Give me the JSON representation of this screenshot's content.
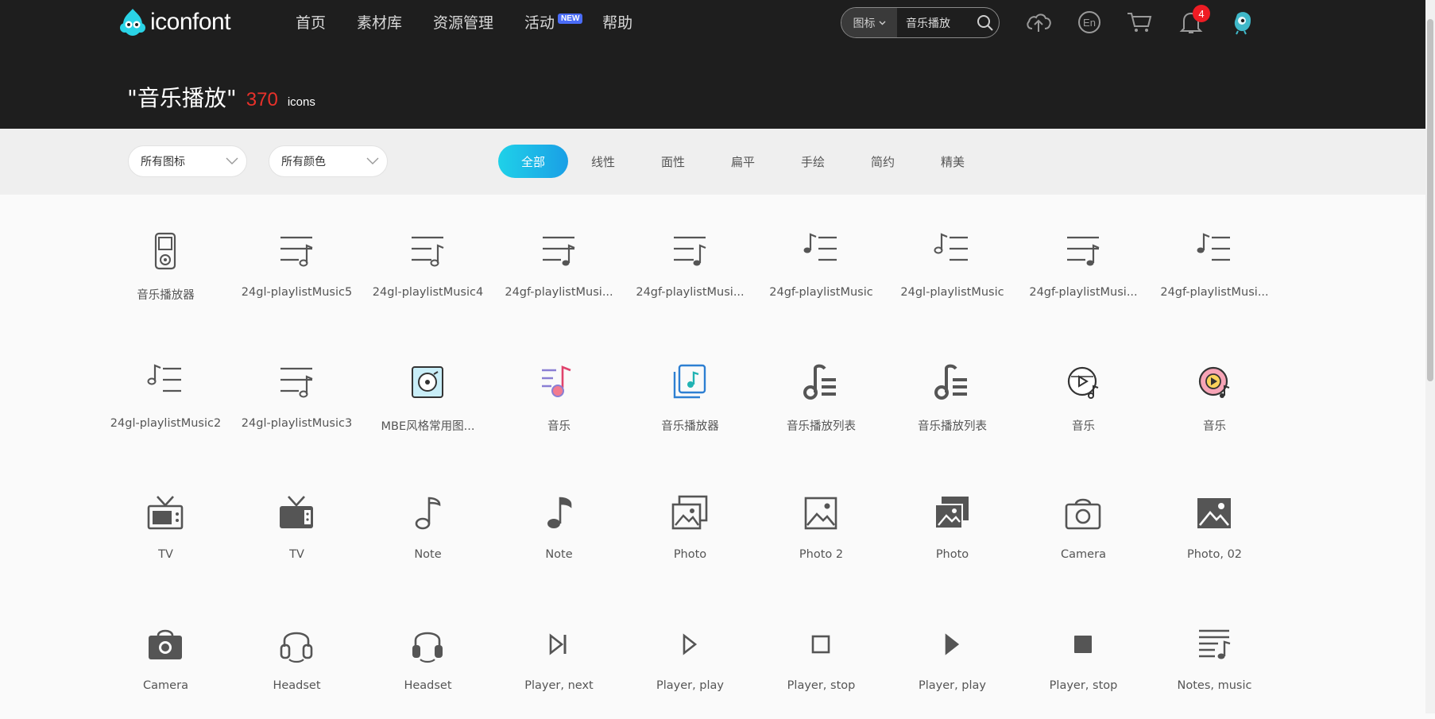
{
  "brand": {
    "name": "iconfont"
  },
  "nav": [
    {
      "label": "首页"
    },
    {
      "label": "素材库"
    },
    {
      "label": "资源管理"
    },
    {
      "label": "活动",
      "badge": "NEW"
    },
    {
      "label": "帮助"
    }
  ],
  "search": {
    "type": "图标",
    "query": "音乐播放"
  },
  "header_icons": [
    "upload-icon",
    "language-en-icon",
    "cart-icon",
    "bell-icon",
    "avatar"
  ],
  "notifications": {
    "count": "4"
  },
  "results": {
    "query_display": "\"音乐播放\"",
    "count": "370",
    "unit": "icons"
  },
  "filters": {
    "icon_type": "所有图标",
    "color": "所有颜色",
    "styles": [
      "全部",
      "线性",
      "面性",
      "扁平",
      "手绘",
      "简约",
      "精美"
    ],
    "active_style": "全部"
  },
  "icons": [
    {
      "label": "音乐播放器",
      "icon": "music-player-device-icon"
    },
    {
      "label": "24gl-playlistMusic5",
      "icon": "playlist-music-icon"
    },
    {
      "label": "24gl-playlistMusic4",
      "icon": "playlist-music-icon"
    },
    {
      "label": "24gf-playlistMusi...",
      "icon": "playlist-music-icon"
    },
    {
      "label": "24gf-playlistMusi...",
      "icon": "playlist-music-icon"
    },
    {
      "label": "24gf-playlistMusic",
      "icon": "playlist-music-icon"
    },
    {
      "label": "24gl-playlistMusic",
      "icon": "playlist-music-icon"
    },
    {
      "label": "24gf-playlistMusi...",
      "icon": "playlist-music-icon"
    },
    {
      "label": "24gf-playlistMusi...",
      "icon": "playlist-music-icon"
    },
    {
      "label": "24gl-playlistMusic2",
      "icon": "playlist-music-icon"
    },
    {
      "label": "24gl-playlistMusic3",
      "icon": "playlist-music-icon"
    },
    {
      "label": "MBE风格常用图...",
      "icon": "mbe-music-player-icon"
    },
    {
      "label": "音乐",
      "icon": "music-colorful-icon"
    },
    {
      "label": "音乐播放器",
      "icon": "music-album-icon"
    },
    {
      "label": "音乐播放列表",
      "icon": "music-list-icon"
    },
    {
      "label": "音乐播放列表",
      "icon": "music-list-icon"
    },
    {
      "label": "音乐",
      "icon": "music-disc-icon"
    },
    {
      "label": "音乐",
      "icon": "music-disc-color-icon"
    },
    {
      "label": "TV",
      "icon": "tv-icon"
    },
    {
      "label": "TV",
      "icon": "tv-filled-icon"
    },
    {
      "label": "Note",
      "icon": "note-outline-icon"
    },
    {
      "label": "Note",
      "icon": "note-filled-icon"
    },
    {
      "label": "Photo",
      "icon": "photo-stack-icon"
    },
    {
      "label": "Photo 2",
      "icon": "photo-icon"
    },
    {
      "label": "Photo",
      "icon": "photo-stack-filled-icon"
    },
    {
      "label": "Camera",
      "icon": "camera-outline-icon"
    },
    {
      "label": "Photo, 02",
      "icon": "photo-filled-icon"
    },
    {
      "label": "Camera",
      "icon": "camera-filled-icon"
    },
    {
      "label": "Headset",
      "icon": "headset-outline-icon"
    },
    {
      "label": "Headset",
      "icon": "headset-filled-icon"
    },
    {
      "label": "Player, next",
      "icon": "player-next-icon"
    },
    {
      "label": "Player, play",
      "icon": "player-play-outline-icon"
    },
    {
      "label": "Player, stop",
      "icon": "player-stop-outline-icon"
    },
    {
      "label": "Player, play",
      "icon": "player-play-filled-icon"
    },
    {
      "label": "Player, stop",
      "icon": "player-stop-filled-icon"
    },
    {
      "label": "Notes, music",
      "icon": "notes-music-icon"
    }
  ],
  "colors": {
    "header_bg": "#1e1e1e",
    "accent_count": "#e8312a",
    "tab_active_from": "#1fd1e8",
    "tab_active_to": "#1a9fe6",
    "icon_gray": "#555555"
  }
}
